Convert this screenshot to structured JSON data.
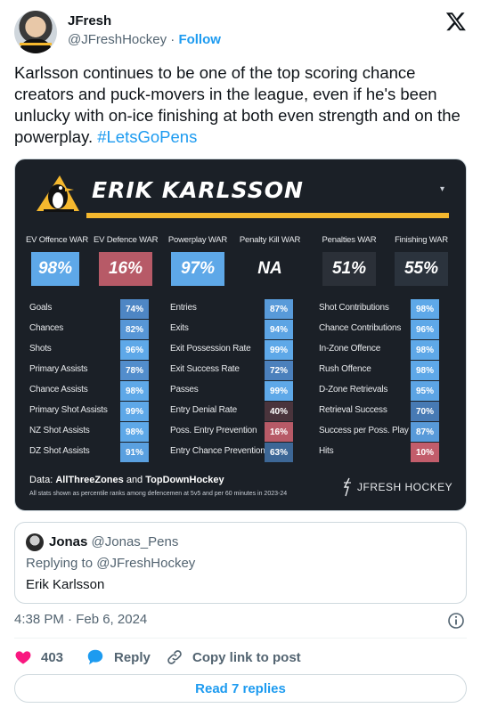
{
  "author": {
    "name": "JFresh",
    "handle": "@JFreshHockey",
    "separator": "·",
    "follow_label": "Follow"
  },
  "tweet": {
    "text": "Karlsson continues to be one of the top scoring chance creators and puck-movers in the league, even if he's been unlucky with on-ice finishing at both even strength and on the powerplay. ",
    "hashtag": "#LetsGoPens"
  },
  "card": {
    "player_name": "ERIK KARLSSON",
    "war": [
      {
        "label": "EV Offence WAR",
        "value": "98%",
        "color": "#5ea8e8"
      },
      {
        "label": "EV Defence WAR",
        "value": "16%",
        "color": "#b75a67"
      },
      {
        "label": "Powerplay WAR",
        "value": "97%",
        "color": "#5ea8e8"
      },
      {
        "label": "Penalty Kill WAR",
        "value": "NA",
        "color": "#1b2027"
      },
      {
        "label": "Penalties WAR",
        "value": "51%",
        "color": "#2b3038"
      },
      {
        "label": "Finishing WAR",
        "value": "55%",
        "color": "#2b333d"
      }
    ],
    "columns": [
      [
        {
          "label": "Goals",
          "value": "74%",
          "color": "#4e86c4"
        },
        {
          "label": "Chances",
          "value": "82%",
          "color": "#5796d6"
        },
        {
          "label": "Shots",
          "value": "96%",
          "color": "#5ea8e8"
        },
        {
          "label": "Primary Assists",
          "value": "78%",
          "color": "#528dcc"
        },
        {
          "label": "Chance Assists",
          "value": "98%",
          "color": "#5ea8e8"
        },
        {
          "label": "Primary Shot Assists",
          "value": "99%",
          "color": "#5ea8e8"
        },
        {
          "label": "NZ Shot Assists",
          "value": "98%",
          "color": "#5ea8e8"
        },
        {
          "label": "DZ Shot Assists",
          "value": "91%",
          "color": "#5aa0e0"
        }
      ],
      [
        {
          "label": "Entries",
          "value": "87%",
          "color": "#589ad9"
        },
        {
          "label": "Exits",
          "value": "94%",
          "color": "#5ca4e4"
        },
        {
          "label": "Exit Possession Rate",
          "value": "99%",
          "color": "#5ea8e8"
        },
        {
          "label": "Exit Success Rate",
          "value": "72%",
          "color": "#4b80bc"
        },
        {
          "label": "Passes",
          "value": "99%",
          "color": "#5ea8e8"
        },
        {
          "label": "Entry Denial Rate",
          "value": "40%",
          "color": "#4a343c"
        },
        {
          "label": "Poss. Entry Prevention",
          "value": "16%",
          "color": "#b75a67"
        },
        {
          "label": "Entry Chance Prevention",
          "value": "63%",
          "color": "#3d6796"
        }
      ],
      [
        {
          "label": "Shot Contributions",
          "value": "98%",
          "color": "#5ea8e8"
        },
        {
          "label": "Chance Contributions",
          "value": "96%",
          "color": "#5ea8e8"
        },
        {
          "label": "In-Zone Offence",
          "value": "98%",
          "color": "#5ea8e8"
        },
        {
          "label": "Rush Offence",
          "value": "98%",
          "color": "#5ea8e8"
        },
        {
          "label": "D-Zone Retrievals",
          "value": "95%",
          "color": "#5ca4e4"
        },
        {
          "label": "Retrieval Success",
          "value": "70%",
          "color": "#477ab4"
        },
        {
          "label": "Success per Poss. Play",
          "value": "87%",
          "color": "#589ad9"
        },
        {
          "label": "Hits",
          "value": "10%",
          "color": "#c25d6b"
        }
      ]
    ],
    "data_prefix": "Data: ",
    "data_source_a": "AllThreeZones",
    "data_and": " and ",
    "data_source_b": "TopDownHockey",
    "data_note": "All stats shown as percentile ranks among defencemen at 5v5 and per 60 minutes in 2023-24",
    "brand": "JFRESH HOCKEY"
  },
  "quote": {
    "name": "Jonas",
    "handle": "@Jonas_Pens",
    "replying": "Replying to @JFreshHockey",
    "text": "Erik Karlsson"
  },
  "timestamp": "4:38 PM · Feb 6, 2024",
  "actions": {
    "likes": "403",
    "reply_label": "Reply",
    "copy_label": "Copy link to post"
  },
  "read_replies": "Read 7 replies",
  "colors": {
    "accent": "#1d9bf0",
    "like": "#f91880",
    "card_bg": "#1b2027",
    "gold": "#f5b82e"
  }
}
